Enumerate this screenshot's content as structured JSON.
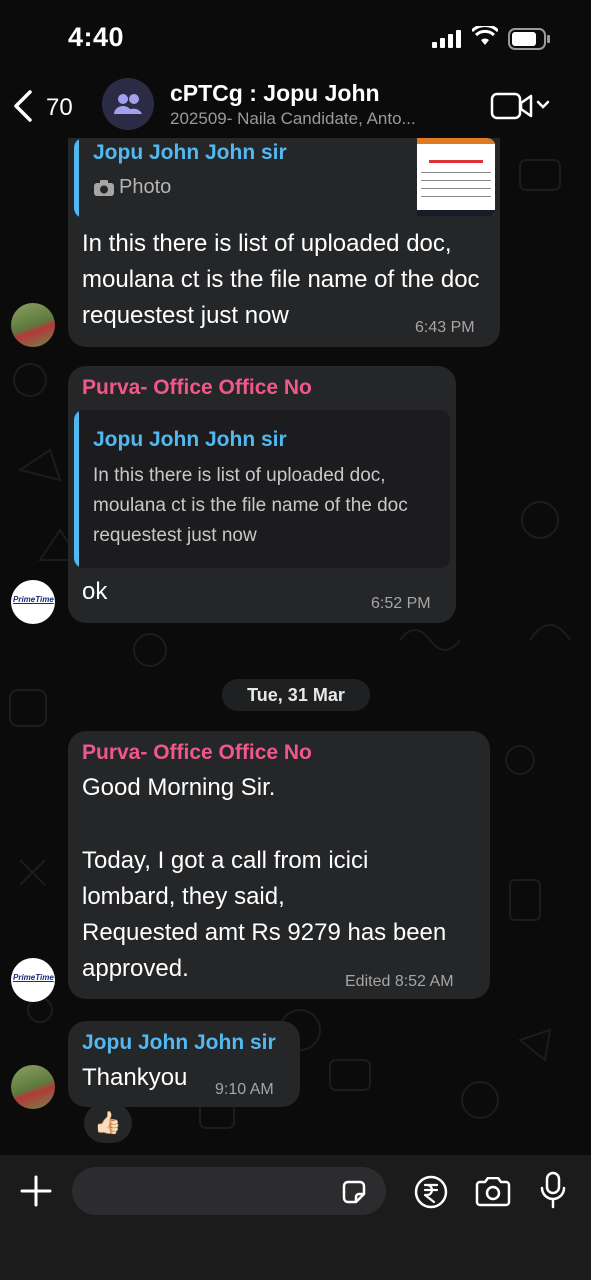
{
  "status_bar": {
    "time": "4:40"
  },
  "header": {
    "back_count": "70",
    "title": "cPTCg : Jopu John",
    "subtitle": "202509- Naila Candidate, Anto..."
  },
  "messages": [
    {
      "quote_name": "Jopu John John sir",
      "quote_label": "Photo",
      "text": "In this there is list of uploaded doc, moulana ct is the file name of the doc requestest just now",
      "time": "6:43 PM"
    },
    {
      "sender": "Purva- Office Office No",
      "quote_name": "Jopu John John sir",
      "quote_text": "In this there is list of uploaded doc, moulana ct is the file name of the doc requestest just now",
      "text": "ok",
      "time": "6:52 PM"
    },
    {
      "sender": "Purva- Office Office No",
      "line1": "Good Morning Sir.",
      "line2": "Today, I got a call from icici lombard, they said,",
      "line3": "Requested amt Rs 9279 has been approved.",
      "time": "Edited 8:52 AM"
    },
    {
      "sender": "Jopu John John sir",
      "text": "Thankyou",
      "time": "9:10 AM",
      "reaction": "👍🏻"
    }
  ],
  "date_separator": "Tue, 31 Mar",
  "avatar_logo_text": "PrimeTime",
  "icons": [
    "back-chevron-icon",
    "group-icon",
    "video-call-icon",
    "photo-icon",
    "plus-icon",
    "sticker-icon",
    "rupee-icon",
    "camera-icon",
    "mic-icon"
  ]
}
